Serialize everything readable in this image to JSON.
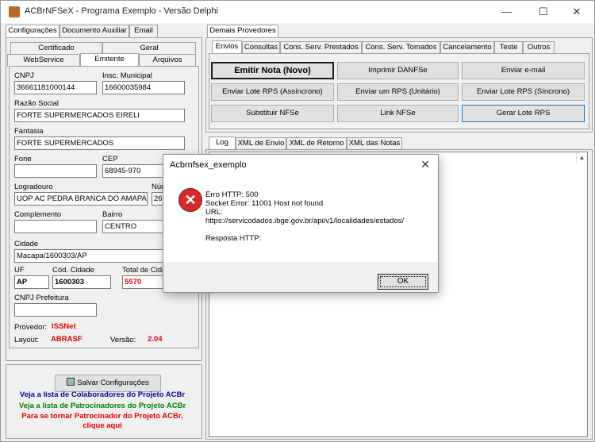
{
  "window": {
    "title": "ACBrNFSeX - Programa Exemplo - Versão Delphi",
    "minimize": "—",
    "maximize": "☐",
    "close": "✕"
  },
  "left_tabs": {
    "row1": [
      "Configurações",
      "Documento Auxiliar",
      "Email"
    ],
    "row2": [
      "Certificado",
      "Geral"
    ],
    "row3": [
      "WebService",
      "Emitente",
      "Arquivos"
    ]
  },
  "emitente": {
    "cnpj_label": "CNPJ",
    "cnpj": "36661181000144",
    "insc_label": "Insc. Municipal",
    "insc": "16600035984",
    "razao_label": "Razão Social",
    "razao": "FORTE SUPERMERCADOS EIRELI",
    "fantasia_label": "Fantasia",
    "fantasia": "FORTE SUPERMERCADOS",
    "fone_label": "Fone",
    "fone": "",
    "cep_label": "CEP",
    "cep": "68945-970",
    "logradouro_label": "Logradouro",
    "logradouro": "UOP AC PEDRA BRANCA DO AMAPARI -",
    "numero_label": "Núm",
    "numero": "26",
    "complemento_label": "Complemento",
    "complemento": "",
    "bairro_label": "Bairro",
    "bairro": "CENTRO",
    "cidade_label": "Cidade",
    "cidade": "Macapa/1600303/AP",
    "uf_label": "UF",
    "uf": "AP",
    "cod_cidade_label": "Cód. Cidade",
    "cod_cidade": "1600303",
    "total_cid_label": "Total de Cida",
    "total_cid": "5570",
    "cnpj_pref_label": "CNPJ Prefeitura",
    "cnpj_pref": "",
    "provedor_label": "Provedor:",
    "provedor": "ISSNet",
    "layout_label": "Layout:",
    "layout": "ABRASF",
    "versao_label": "Versão:",
    "versao": "2.04"
  },
  "bottom_left": {
    "save_label": "Salvar Configurações",
    "link1": "Veja a lista de Colaboradores do Projeto ACBr",
    "link2": "Veja a lista de Patrocinadores do Projeto ACBr",
    "link3a": "Para se tornar Patrocinador do Projeto ACBr,",
    "link3b": "clique aqui"
  },
  "right_tabs": {
    "top": "Demais Provedores",
    "row": [
      "Envios",
      "Consultas",
      "Cons. Serv. Prestados",
      "Cons. Serv. Tomados",
      "Cancelamento",
      "Teste",
      "Outros"
    ]
  },
  "actions": {
    "emitir": "Emitir Nota (Novo)",
    "imprimir": "Imprimir DANFSe",
    "enviar_email": "Enviar e-mail",
    "lote_assinc": "Enviar Lote RPS (Assíncrono)",
    "um_rps": "Enviar um RPS (Unitário)",
    "lote_sinc": "Enviar Lote RPS (Síncrono)",
    "substituir": "Substituir NFSe",
    "link_nfse": "Link NFSe",
    "gerar_lote": "Gerar Lote RPS"
  },
  "log_tabs": [
    "Log",
    "XML de Envio",
    "XML de Retorno",
    "XML das Notas"
  ],
  "dialog": {
    "title": "Acbrnfsex_exemplo",
    "close": "✕",
    "line1": "Erro HTTP: 500",
    "line2": "Socket Error: 11001 Host not found",
    "line3": "URL:",
    "line4": "https://servicodados.ibge.gov.br/api/v1/localidades/estados/",
    "line5": "Resposta HTTP:",
    "ok": "OK"
  },
  "colors": {
    "link_blue": "#0000a0",
    "link_green": "#008000",
    "link_red": "#e00000",
    "error_red": "#d42a2a"
  }
}
